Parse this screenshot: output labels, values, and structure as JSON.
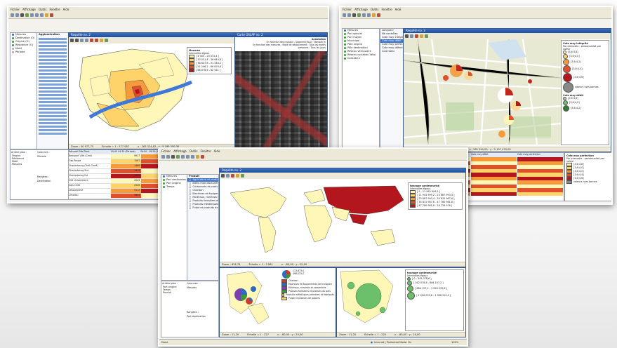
{
  "menu": [
    "Fichier",
    "Affichage",
    "Outils",
    "Fenêtre",
    "Aide"
  ],
  "shot1": {
    "window_title": "Requête no. 2",
    "photo_title": "Carte OSLAP no. 2",
    "legend_title": "Mesures",
    "legend_subtitle": "Intervalles égaux",
    "legend_items": [
      "[ 4 000 - 20 031,4 ]",
      "] 20 031,4 - 36 649,8 ]",
      "] 36 647,8 - 51 246,2 ]",
      "] 51 246,2 - 66 878,6 ]",
      "] 66 878,6 - 82 431 ]"
    ],
    "tree_items": [
      "Mesures",
      "Destination (O)",
      "Origine (O)",
      "Résidence (O)",
      "Motif",
      "Période"
    ],
    "tree_header": "Agglomération",
    "status_zoom": "Zoom : 50 977,75",
    "status_scale": "Échelle = 1 : 577 087",
    "status_xy": "x : 263 324,82 · y : 5 195 250,30",
    "photo_text_1": "Annotation",
    "photo_text_2": "En fonction des niveaux : Segment(RLA) : Nombre m",
    "photo_text_3": "En fonction des mesures : Motif de déplacement : Tous les motifs",
    "photo_text_4": "personne : Tous les jours",
    "lower_left_labels": [
      "Arrière-plan :",
      "Origine",
      "Résidence",
      "Motif",
      "Mesures"
    ],
    "lower_cols_label": "Colonnes :",
    "lower_cols_value": "Période",
    "lower_rows_label": "Rangées :",
    "lower_rows_value": "Destination",
    "table_header": [
      "Résumé Ville Dest.",
      "00:00 04:30 (Période)",
      "06:00 - 08:59 (Période)"
    ],
    "table_rows": [
      "Beauport Ville (Cent)",
      "Cap-Rouge",
      "Charlesbourg (Trait-Carré)",
      "Charlesbourg Sud",
      "Charlesbourg Est",
      "Cité Universitaire",
      "Cœur-Ville",
      "Lebourgneuf",
      "Limoilou"
    ],
    "table_vals": [
      "9917",
      "1567",
      "1489",
      "1413",
      "1094",
      "2049",
      "2926",
      "5173",
      "5604"
    ]
  },
  "shot2": {
    "window_title": "Requête no. 2",
    "tree_items": [
      "Mesures",
      "Port spécial",
      "Port moyen",
      "Municipal",
      "Pôle origine",
      "Pôle destination",
      "Réseau véhiculaire",
      "Réseau cyclable (Vélo)",
      "Indicateur"
    ],
    "list_items": [
      "Longueur",
      "Nb contrôles",
      "Cote moy intégrité",
      "Cote moy débit",
      "Cote moy perfection",
      "Cote moy défectuosité",
      "Coût total"
    ],
    "legend1_title": "Cote moy intégrité",
    "legend1_sub": "Par intervalle - personnalisé par valeur",
    "legend1_items": [
      "[3,6;3,8]",
      "[3,6;4,0]",
      "[3,6;4,2]",
      "[3,6;4,4]",
      "[3,6;4,6]",
      "valeurs hors bornes"
    ],
    "legend2_title": "Cote moy débit",
    "legend2_items": [
      "[3,6;3,8]",
      "[3,6;4,0]",
      "[3,6;4,2]"
    ],
    "legend3_title": "Cote moy perfection",
    "legend3_sub": "Par intervalle - personnalisé par valeur",
    "legend3_items": [
      "[3,6;3,8]",
      "[3,6;4,0]",
      "[3,6;4,2]",
      "[3,6;4,4]",
      "[3,6;4,6]",
      "valeurs hors bornes"
    ],
    "status_zoom": "Zoom : 2 066,79",
    "status_scale": "Échelle = 1 : 14 665",
    "status_xy": "x : 262 540,00 · y : 5 197 470,00",
    "table_cols": [
      "Cote moy intégrité",
      "Cote moy débit",
      "Cote moy perfection"
    ]
  },
  "shot3": {
    "window_title": "Requête no. 2",
    "tree_items": [
      "Mesures",
      "Port destination",
      "Port origine",
      "Temps"
    ],
    "product_header": "Produit",
    "product_items": [
      "Agriculture et produits",
      "Biens manufacturiers",
      "Carburants et produits",
      "Charbon",
      "Machines et équipements",
      "Minéraux, minerais et",
      "Produits forestiers et",
      "Produits métalliques",
      "Pulpe et produits de"
    ],
    "legend_title": "tonnage conteneurisé",
    "legend_subtitle": "Intervalles égaux",
    "legend_items": [
      "[ 5 - 11 943 999,2 ]",
      "] 11 943 999,2 - 23 887 993,4 ]",
      "] 23 887 993,4 - 35 831 987,6 ]",
      "] 35 831 987,6 - 47 780 981,8 ]",
      "] 47 780 981,8 - 59 719 976 ]"
    ],
    "status_zoom": "Zoom : 624,74",
    "status_scale": "Échelle = 1 : 3 561",
    "status_xy": "x : -80,09 · y : 25,00",
    "pie_legend_value1": "113,873,0",
    "pie_legend_value2": "498,021,0",
    "pie_legend_items": [
      "Charbon",
      "Machines et équipements de transport",
      "Minéraux, minerais et concentrés",
      "Produits forestiers et produits du bois",
      "Produits métalliques primaires et fabriqués",
      "Pulpe et produits de papiers"
    ],
    "circle_legend_title": "tonnage conteneurisé",
    "circle_legend_sub": "Intervalles égaux",
    "circle_legend_items": [
      "[ 0 - 342 078,6 ]",
      "] 342 078,6 - 684 157,2 ]",
      "] 684 157,2 - 1 026 235,8 ]",
      "] 1 026 235,8 - 1 368 314,4 ]"
    ],
    "left_labels": [
      "Arrière-plan :",
      "Port origine",
      "Temps",
      "Produit"
    ],
    "cols_label": "Colonnes :",
    "cols_value": "Mesures",
    "rows_label": "Rangées :",
    "rows_value": "Port destination",
    "bottom_status_left": "Zoom : 11,20",
    "bottom_status_scale": "Échelle = 1 : 227",
    "bottom_status_xy": "x : -80,00 · y : 25,00",
    "bottom2_status_left": "Zoom : 11,20",
    "bottom2_status_scale": "Échelle = 1 : 225",
    "bottom2_status_xy": "x : -80,00 · y : 25,00",
    "done": "Done",
    "browser_zone": "Internet | Protected Mode: On",
    "zoom_pct": "100%"
  },
  "colors": {
    "choro": [
      "#fff7b8",
      "#fdd36a",
      "#f79a3a",
      "#e0502a",
      "#b3161c"
    ],
    "titlebar": "#2a5aa8",
    "chrome": "#ece9d8"
  }
}
